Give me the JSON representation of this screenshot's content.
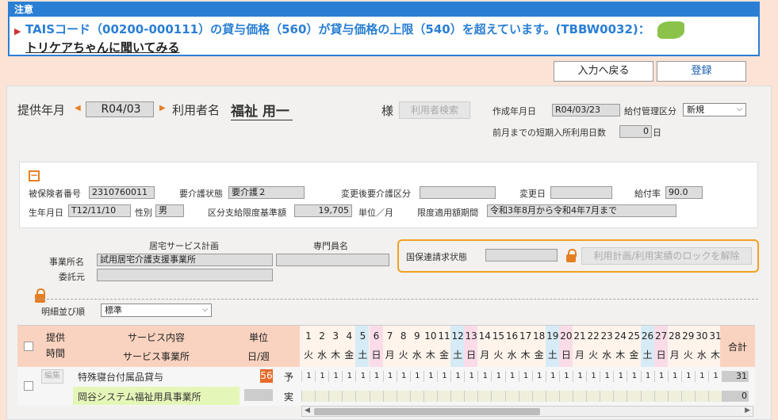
{
  "alert": {
    "title": "注意",
    "message": "TAISコード（00200-000111）の貸与価格（560）が貸与価格の上限（540）を超えています。(TBBW0032)：",
    "link": "トリケアちゃんに聞いてみる"
  },
  "toolbar": {
    "back_label": "入力へ戻る",
    "register_label": "登録"
  },
  "header": {
    "provide_month_label": "提供年月",
    "provide_month": "R04/03",
    "user_label": "利用者名",
    "user_name": "福祉 用一",
    "honorific": "様",
    "user_search_label": "利用者検索",
    "created_label": "作成年月日",
    "created": "R04/03/23",
    "benefit_label": "給付管理区分",
    "benefit_value": "新規",
    "prev_days_label": "前月までの短期入所利用日数",
    "prev_days": "0",
    "days_unit": "日"
  },
  "insured": {
    "collapse_icon": "minus-box-icon",
    "number_label": "被保険者番号",
    "number": "2310760011",
    "care_label": "要介護状態",
    "care": "要介護２",
    "changed_care_label": "変更後要介護区分",
    "changed_care": "",
    "change_date_label": "変更日",
    "change_date": "",
    "rate_label": "給付率",
    "rate": "90.0",
    "birth_label": "生年月日",
    "birth": "T12/11/10",
    "sex_label": "性別",
    "sex": "男",
    "limit_label": "区分支給限度基準額",
    "limit": "19,705",
    "limit_unit": "単位／月",
    "period_label": "限度適用額期間",
    "period": "令和3年8月から令和4年7月まで"
  },
  "plan": {
    "section_label": "居宅サービス計画",
    "specialist_label": "専門員名",
    "office_label": "事業所名",
    "office": "試用居宅介護支援事業所",
    "specialist": "",
    "consign_label": "委託元",
    "consign": "",
    "status_label": "国保連請求状態",
    "status": "",
    "unlock_label": "利用計画/利用実績のロックを解除"
  },
  "sort": {
    "label": "明細並び順",
    "value": "標準"
  },
  "table": {
    "headers": {
      "time1": "提供",
      "time2": "時間",
      "service": "サービス内容",
      "office": "サービス事業所",
      "unit1": "単位",
      "unit2": "日/週",
      "total": "合計"
    },
    "days": [
      "1",
      "2",
      "3",
      "4",
      "5",
      "6",
      "7",
      "8",
      "9",
      "10",
      "11",
      "12",
      "13",
      "14",
      "15",
      "16",
      "17",
      "18",
      "19",
      "20",
      "21",
      "22",
      "23",
      "24",
      "25",
      "26",
      "27",
      "28",
      "29",
      "30",
      "31"
    ],
    "weekdays": [
      "火",
      "水",
      "木",
      "金",
      "土",
      "日",
      "月",
      "火",
      "水",
      "木",
      "金",
      "土",
      "日",
      "月",
      "火",
      "水",
      "木",
      "金",
      "土",
      "日",
      "月",
      "火",
      "水",
      "木",
      "金",
      "土",
      "日",
      "月",
      "火",
      "水",
      "木"
    ],
    "row": {
      "edit_label": "編集",
      "service": "特殊寝台付属品貸与",
      "office": "岡谷システム福祉用具事業所",
      "unit": "56",
      "plan_label": "予",
      "actual_label": "実",
      "plan_total": "31",
      "actual_total": "0",
      "plan_count": "1"
    }
  }
}
